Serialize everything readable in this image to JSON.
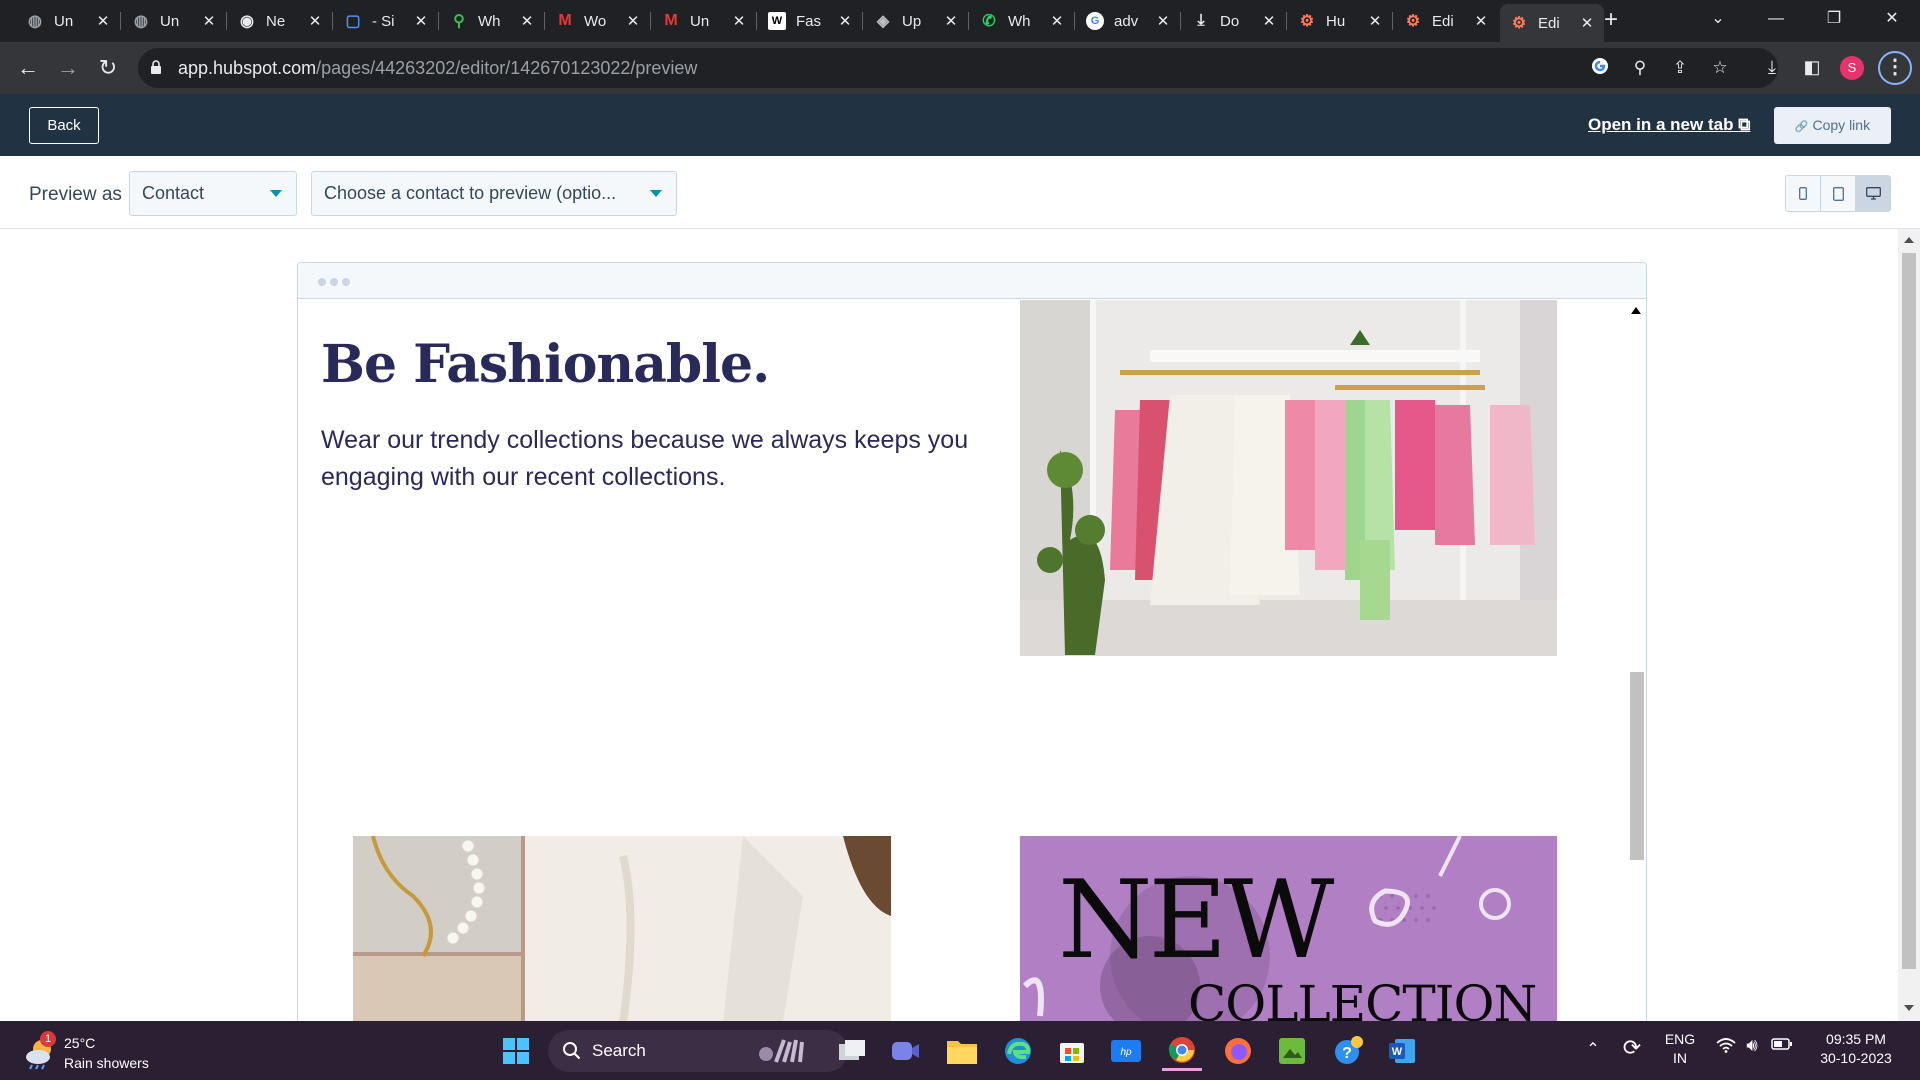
{
  "browser": {
    "tabs": [
      {
        "title": "Un",
        "icon": "globe-icon"
      },
      {
        "title": "Un",
        "icon": "globe-icon"
      },
      {
        "title": "Ne",
        "icon": "chrome-icon"
      },
      {
        "title": "- Si",
        "icon": "app-icon"
      },
      {
        "title": "Wh",
        "icon": "leaf-icon"
      },
      {
        "title": "Wo",
        "icon": "m-logo-icon"
      },
      {
        "title": "Un",
        "icon": "m-logo-icon"
      },
      {
        "title": "Fas",
        "icon": "w-logo-icon"
      },
      {
        "title": "Up",
        "icon": "layers-icon"
      },
      {
        "title": "Wh",
        "icon": "whatsapp-icon"
      },
      {
        "title": "adv",
        "icon": "google-icon"
      },
      {
        "title": "Do",
        "icon": "download-icon"
      },
      {
        "title": "Hu",
        "icon": "hubspot-icon"
      },
      {
        "title": "Edi",
        "icon": "hubspot-icon"
      },
      {
        "title": "Edi",
        "icon": "hubspot-icon"
      }
    ],
    "tab_close": "✕",
    "new_tab": "+",
    "url_host": "app.hubspot.com",
    "url_path": "/pages/44263202/editor/142670123022/preview",
    "profile_initial": "S"
  },
  "hubspot_bar": {
    "back_label": "Back",
    "open_new_tab_label": "Open in a new tab",
    "copy_link_label": "Copy link"
  },
  "preview_bar": {
    "preview_as_label": "Preview as",
    "type_value": "Contact",
    "contact_placeholder": "Choose a contact to preview (optio..."
  },
  "page": {
    "heading": "Be Fashionable.",
    "subtext": "Wear our trendy collections because we always keeps you engaging with our recent collections.",
    "promo_title": "NEW",
    "promo_subtitle": "COLLECTION"
  },
  "taskbar": {
    "weather_temp": "25°C",
    "weather_desc": "Rain showers",
    "weather_badge": "1",
    "search_label": "Search",
    "lang_top": "ENG",
    "lang_bottom": "IN",
    "time": "09:35 PM",
    "date": "30-10-2023"
  },
  "colors": {
    "brand_nav": "#213343",
    "accent": "#0091ae",
    "heading": "#2a2a5a",
    "promo_bg": "#b17fc4"
  }
}
